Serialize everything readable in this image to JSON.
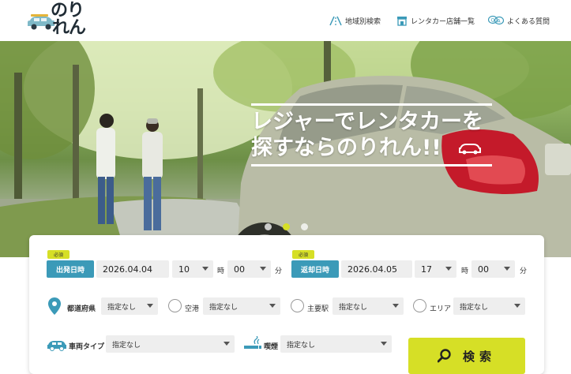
{
  "brand": {
    "logo_line1": "のり",
    "logo_line2": "れん"
  },
  "nav": {
    "area": "地域別検索",
    "stores": "レンタカー店舗一覧",
    "faq": "よくある質問"
  },
  "hero": {
    "line1": "レジャーでレンタカーを",
    "line2": "探すならのりれん!!",
    "slides": 3,
    "active_slide": 2
  },
  "search": {
    "required_badge": "必須",
    "departure": {
      "label": "出発日時",
      "date": "2026.04.04",
      "hour": "10",
      "minute": "00"
    },
    "return": {
      "label": "返却日時",
      "date": "2026.04.05",
      "hour": "17",
      "minute": "00"
    },
    "hour_unit": "時",
    "minute_unit": "分",
    "prefecture": {
      "label": "都道府県",
      "value": "指定なし"
    },
    "airport": {
      "label": "空港",
      "value": "指定なし"
    },
    "station": {
      "label": "主要駅",
      "value": "指定なし"
    },
    "area": {
      "label": "エリア",
      "value": "指定なし"
    },
    "vehicle_type": {
      "label": "車両タイプ",
      "value": "指定なし"
    },
    "smoking": {
      "label": "喫煙",
      "value": "指定なし"
    },
    "button": "検索"
  },
  "colors": {
    "accent": "#d6df26",
    "label_blue": "#3b9ab8"
  }
}
